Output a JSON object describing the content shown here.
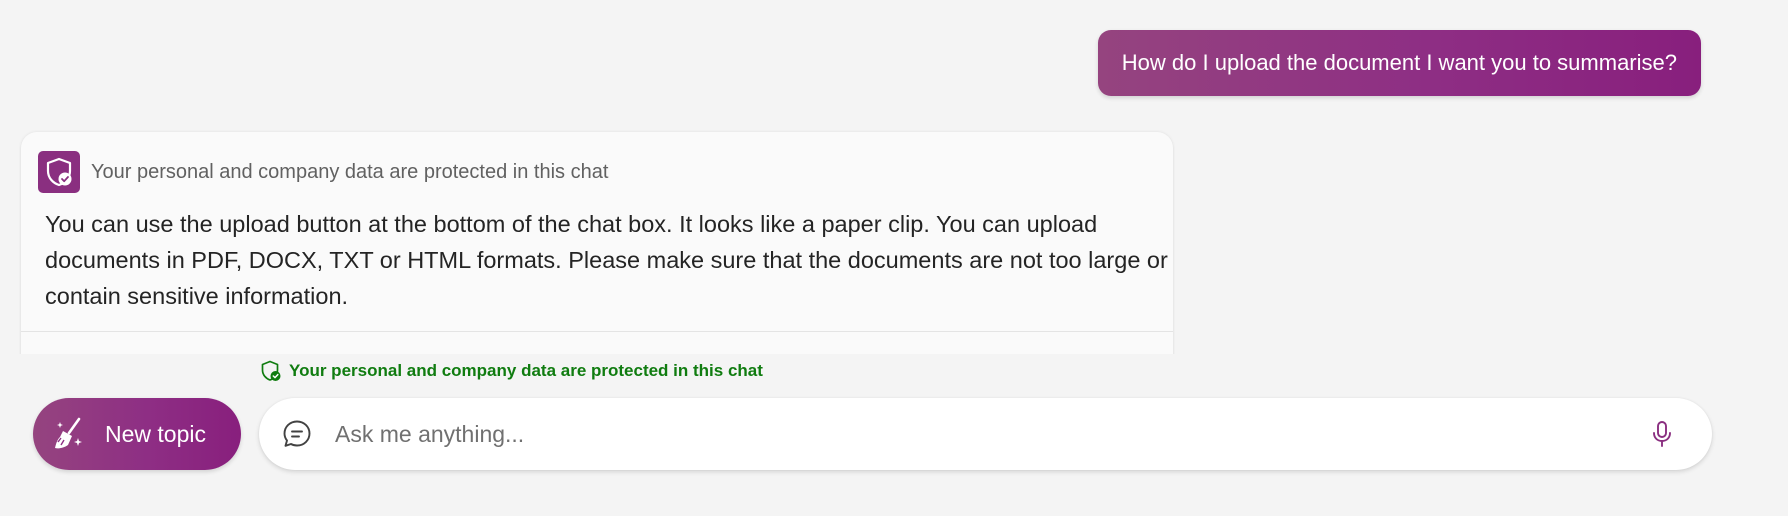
{
  "conversation": {
    "user_message": "How do I upload the document I want you to summarise?",
    "bot_protection_text": "Your personal and company data are protected in this chat",
    "bot_response": "You can use the upload button at the bottom of the chat box. It looks like a paper clip. You can upload documents in PDF, DOCX, TXT or HTML formats. Please make sure that the documents are not too large or contain sensitive information."
  },
  "composer": {
    "protection_notice": "Your personal and company data are protected in this chat",
    "new_topic_label": "New topic",
    "input_placeholder": "Ask me anything...",
    "input_value": ""
  },
  "icons": {
    "shield": "shield-check-icon",
    "broom": "broom-sparkle-icon",
    "chat": "chat-bubble-icon",
    "mic": "microphone-icon"
  },
  "colors": {
    "brand_purple": "#8a2f80",
    "protect_green": "#107c10",
    "page_background": "#f4f4f4"
  }
}
